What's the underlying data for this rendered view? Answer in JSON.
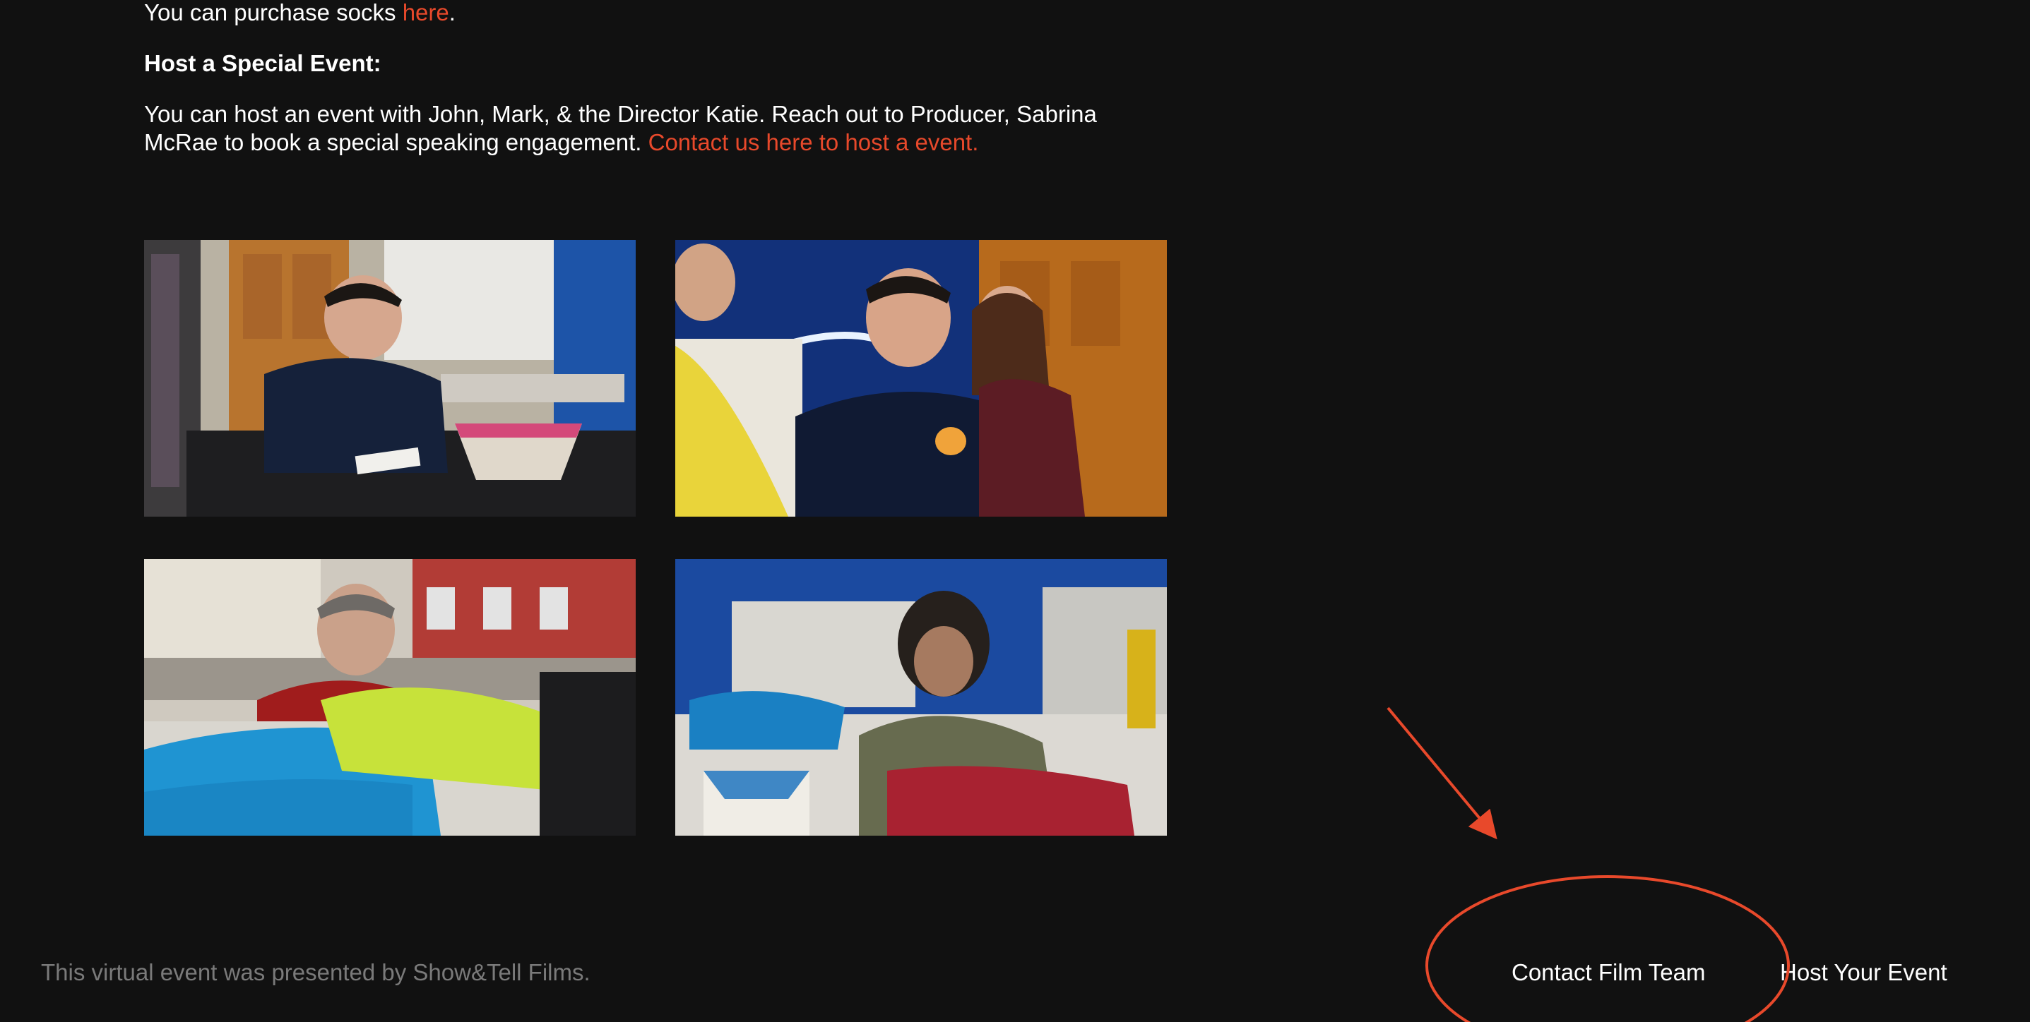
{
  "content": {
    "socks_text": "You can purchase socks ",
    "socks_link": "here",
    "socks_end": ".",
    "heading": "Host a Special Event:",
    "event_text": "You can host an event with John, Mark, & the Director Katie. Reach out to Producer, Sabrina McRae to book a special speaking engagement. ",
    "event_link": "Contact us here to host a event."
  },
  "photos": [
    {
      "name": "man-signing-papers-photo",
      "description_icon": "photo"
    },
    {
      "name": "man-laughing-group-photo",
      "description_icon": "photo"
    },
    {
      "name": "man-sorting-socks-photo",
      "description_icon": "photo"
    },
    {
      "name": "woman-sorting-socks-photo",
      "description_icon": "photo"
    }
  ],
  "footer": {
    "credit": "This virtual event was presented by Show&Tell Films.",
    "contact_label": "Contact Film Team",
    "host_label": "Host Your Event"
  },
  "colors": {
    "background": "#111111",
    "accent": "#e8492b",
    "text": "#ffffff",
    "muted": "#7a7a7a"
  }
}
